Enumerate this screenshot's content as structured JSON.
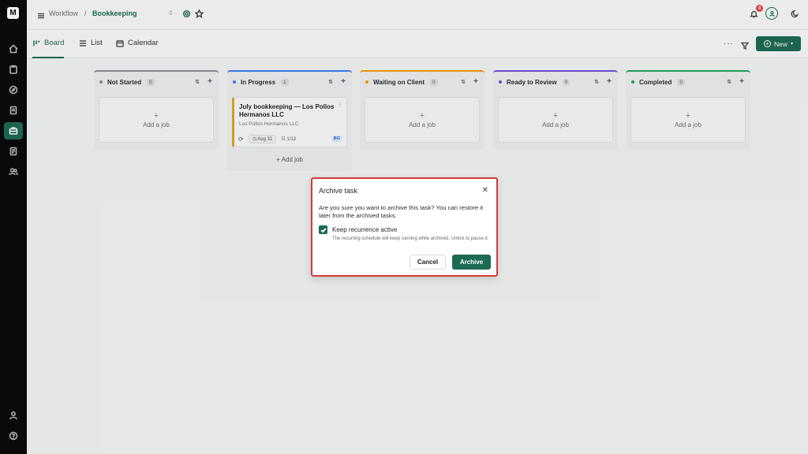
{
  "app": {
    "logo_text": "M"
  },
  "sidebar": {
    "items": [
      {
        "name": "home-icon",
        "active": false
      },
      {
        "name": "clipboard-icon",
        "active": false
      },
      {
        "name": "compass-icon",
        "active": false
      },
      {
        "name": "document-icon",
        "active": false
      },
      {
        "name": "briefcase-icon",
        "active": true
      },
      {
        "name": "notes-icon",
        "active": false
      },
      {
        "name": "people-icon",
        "active": false
      }
    ],
    "bottom": [
      "user-icon",
      "help-icon"
    ]
  },
  "breadcrumb": {
    "parent": "Workflow",
    "separator": "/",
    "current": "Bookkeeping"
  },
  "topbar": {
    "notification_count": "4"
  },
  "views": {
    "board": "Board",
    "list": "List",
    "calendar": "Calendar",
    "new_button": "New"
  },
  "columns": [
    {
      "title": "Not Started",
      "count": "0",
      "color": "#8a8f94",
      "add_job": "Add a job"
    },
    {
      "title": "In Progress",
      "count": "1",
      "color": "#3b82f6",
      "add_job": "Add job"
    },
    {
      "title": "Waiting on Client",
      "count": "0",
      "color": "#f59e0b",
      "add_job": "Add a job"
    },
    {
      "title": "Ready to Review",
      "count": "0",
      "color": "#6d4fd8",
      "add_job": "Add a job"
    },
    {
      "title": "Completed",
      "count": "0",
      "color": "#22a55a",
      "add_job": "Add a job"
    }
  ],
  "task": {
    "title": "July bookkeeping — Los Pollos Hermanos LLC",
    "client": "Los Pollos Hermanos LLC",
    "due": "Aug 31",
    "subtasks": "1/12",
    "assignee": "BG"
  },
  "dialog": {
    "title": "Archive task",
    "body": "Are you sure you want to archive this task? You can restore it later from the archived tasks.",
    "checkbox_label": "Keep recurrence active",
    "checkbox_checked": true,
    "help": "The recurring schedule will keep running while archived. Untick to pause it.",
    "cancel": "Cancel",
    "confirm": "Archive"
  }
}
